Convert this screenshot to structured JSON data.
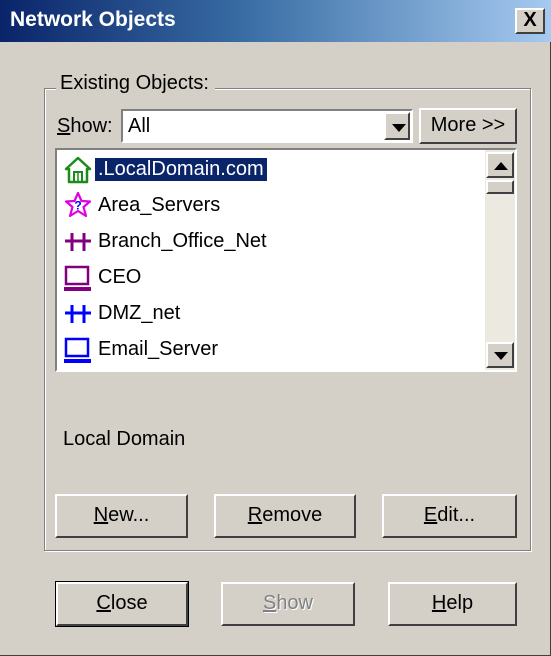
{
  "window": {
    "title": "Network Objects",
    "close_glyph": "X"
  },
  "existing": {
    "group_label": "Existing Objects:",
    "show_label": "Show:",
    "show_label_mnemonic": "S",
    "show_label_rest": "how:",
    "show_value": "All",
    "more_button": "More >>"
  },
  "objects": [
    {
      "name": ".LocalDomain.com",
      "icon": "house-icon",
      "selected": true
    },
    {
      "name": "Area_Servers",
      "icon": "star-group-icon",
      "selected": false
    },
    {
      "name": "Branch_Office_Net",
      "icon": "network-icon",
      "selected": false
    },
    {
      "name": "CEO",
      "icon": "workstation-icon",
      "selected": false
    },
    {
      "name": "DMZ_net",
      "icon": "network-icon",
      "selected": false
    },
    {
      "name": "Email_Server",
      "icon": "server-icon",
      "selected": false
    }
  ],
  "selected_description": "Local Domain",
  "actions": {
    "new": {
      "label": "New...",
      "mnemonic": "N",
      "rest": "ew..."
    },
    "remove": {
      "label": "Remove",
      "mnemonic": "R",
      "rest": "emove"
    },
    "edit": {
      "label": "Edit...",
      "mnemonic": "E",
      "rest": "dit..."
    }
  },
  "footer": {
    "close": {
      "label": "Close",
      "mnemonic": "C",
      "rest": "lose"
    },
    "show": {
      "label": "Show",
      "mnemonic": "S",
      "rest": "how",
      "disabled": true
    },
    "help": {
      "label": "Help",
      "mnemonic": "H",
      "rest": "elp"
    }
  },
  "colors": {
    "title_gradient_start": "#0a246a",
    "title_gradient_end": "#a6caf0",
    "selection": "#0a246a",
    "face": "#d4d0c8",
    "icon_green": "#1a8c1a",
    "icon_magenta": "#e000e0",
    "icon_purple": "#800080",
    "icon_blue": "#0000ff"
  }
}
